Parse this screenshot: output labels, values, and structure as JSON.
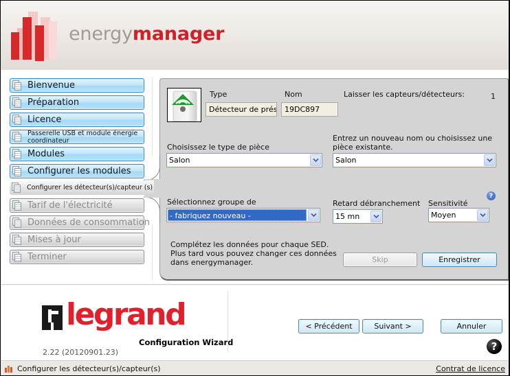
{
  "header": {
    "brand_light": "energy",
    "brand_bold": "manager",
    "brand_color": "#d0202a"
  },
  "sidebar": {
    "items": [
      {
        "label": "Bienvenue",
        "state": "done"
      },
      {
        "label": "Préparation",
        "state": "done"
      },
      {
        "label": "Licence",
        "state": "done"
      },
      {
        "label": "Passerelle USB et module énergie coordinateur",
        "state": "done"
      },
      {
        "label": "Modules",
        "state": "done"
      },
      {
        "label": "Configurer les modules",
        "state": "done"
      },
      {
        "label": "Configurer les détecteur(s)/capteur (s)",
        "state": "current"
      },
      {
        "label": "Tarif de l'électricité",
        "state": "pending"
      },
      {
        "label": "Données de consommation",
        "state": "pending"
      },
      {
        "label": "Mises à jour",
        "state": "pending"
      },
      {
        "label": "Terminer",
        "state": "pending"
      }
    ],
    "item_icon": "document-stack-icon"
  },
  "panel": {
    "device_image": "presence-detector-icon",
    "type_label": "Type",
    "type_value": "Détecteur de présen",
    "name_label": "Nom",
    "name_value": "19DC897",
    "remaining_label": "Laisser les capteurs/détecteurs:",
    "remaining_value": "1",
    "room_type_label": "Choisissez le type de pièce",
    "room_type_value": "Salon",
    "room_name_label": "Entrez un nouveau nom ou choisissez une pièce existante.",
    "room_name_value": "Salon",
    "group_label": "Sélectionnez groupe de",
    "group_value": "- fabriquez nouveau -",
    "delay_label": "Retard débranchement",
    "delay_value": "15 mn",
    "sensitivity_label": "Sensitivité",
    "sensitivity_value": "Moyen",
    "help_icon": "?",
    "info_line1": "Complétez les données pour chaque SED.",
    "info_line2": "Plus tard vous pouvez changer ces données dans energymanager.",
    "skip_label": "Skip",
    "save_label": "Enregistrer"
  },
  "footer": {
    "logo_word": "legrand",
    "logo_color": "#e0202d",
    "wizard_title": "Configuration Wizard",
    "version": "2.22 (20120901.23)",
    "prev_label": "< Précédent",
    "next_label": "Suivant >",
    "cancel_label": "Annuler",
    "help_icon": "?"
  },
  "statusbar": {
    "text": "Configurer les détecteur(s)/capteur(s)",
    "license_link": "Contrat de licence"
  }
}
